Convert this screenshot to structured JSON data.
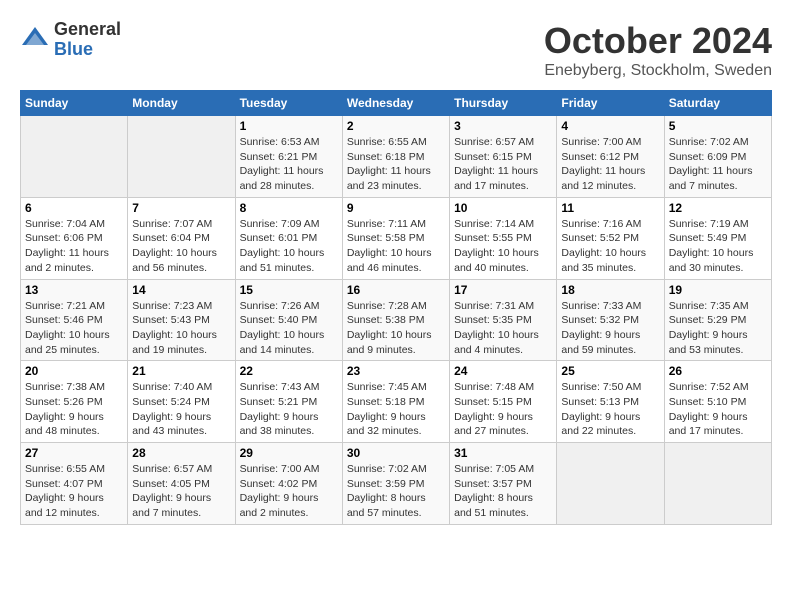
{
  "logo": {
    "general": "General",
    "blue": "Blue"
  },
  "header": {
    "month": "October 2024",
    "location": "Enebyberg, Stockholm, Sweden"
  },
  "weekdays": [
    "Sunday",
    "Monday",
    "Tuesday",
    "Wednesday",
    "Thursday",
    "Friday",
    "Saturday"
  ],
  "weeks": [
    [
      {
        "day": "",
        "info": ""
      },
      {
        "day": "",
        "info": ""
      },
      {
        "day": "1",
        "info": "Sunrise: 6:53 AM\nSunset: 6:21 PM\nDaylight: 11 hours and 28 minutes."
      },
      {
        "day": "2",
        "info": "Sunrise: 6:55 AM\nSunset: 6:18 PM\nDaylight: 11 hours and 23 minutes."
      },
      {
        "day": "3",
        "info": "Sunrise: 6:57 AM\nSunset: 6:15 PM\nDaylight: 11 hours and 17 minutes."
      },
      {
        "day": "4",
        "info": "Sunrise: 7:00 AM\nSunset: 6:12 PM\nDaylight: 11 hours and 12 minutes."
      },
      {
        "day": "5",
        "info": "Sunrise: 7:02 AM\nSunset: 6:09 PM\nDaylight: 11 hours and 7 minutes."
      }
    ],
    [
      {
        "day": "6",
        "info": "Sunrise: 7:04 AM\nSunset: 6:06 PM\nDaylight: 11 hours and 2 minutes."
      },
      {
        "day": "7",
        "info": "Sunrise: 7:07 AM\nSunset: 6:04 PM\nDaylight: 10 hours and 56 minutes."
      },
      {
        "day": "8",
        "info": "Sunrise: 7:09 AM\nSunset: 6:01 PM\nDaylight: 10 hours and 51 minutes."
      },
      {
        "day": "9",
        "info": "Sunrise: 7:11 AM\nSunset: 5:58 PM\nDaylight: 10 hours and 46 minutes."
      },
      {
        "day": "10",
        "info": "Sunrise: 7:14 AM\nSunset: 5:55 PM\nDaylight: 10 hours and 40 minutes."
      },
      {
        "day": "11",
        "info": "Sunrise: 7:16 AM\nSunset: 5:52 PM\nDaylight: 10 hours and 35 minutes."
      },
      {
        "day": "12",
        "info": "Sunrise: 7:19 AM\nSunset: 5:49 PM\nDaylight: 10 hours and 30 minutes."
      }
    ],
    [
      {
        "day": "13",
        "info": "Sunrise: 7:21 AM\nSunset: 5:46 PM\nDaylight: 10 hours and 25 minutes."
      },
      {
        "day": "14",
        "info": "Sunrise: 7:23 AM\nSunset: 5:43 PM\nDaylight: 10 hours and 19 minutes."
      },
      {
        "day": "15",
        "info": "Sunrise: 7:26 AM\nSunset: 5:40 PM\nDaylight: 10 hours and 14 minutes."
      },
      {
        "day": "16",
        "info": "Sunrise: 7:28 AM\nSunset: 5:38 PM\nDaylight: 10 hours and 9 minutes."
      },
      {
        "day": "17",
        "info": "Sunrise: 7:31 AM\nSunset: 5:35 PM\nDaylight: 10 hours and 4 minutes."
      },
      {
        "day": "18",
        "info": "Sunrise: 7:33 AM\nSunset: 5:32 PM\nDaylight: 9 hours and 59 minutes."
      },
      {
        "day": "19",
        "info": "Sunrise: 7:35 AM\nSunset: 5:29 PM\nDaylight: 9 hours and 53 minutes."
      }
    ],
    [
      {
        "day": "20",
        "info": "Sunrise: 7:38 AM\nSunset: 5:26 PM\nDaylight: 9 hours and 48 minutes."
      },
      {
        "day": "21",
        "info": "Sunrise: 7:40 AM\nSunset: 5:24 PM\nDaylight: 9 hours and 43 minutes."
      },
      {
        "day": "22",
        "info": "Sunrise: 7:43 AM\nSunset: 5:21 PM\nDaylight: 9 hours and 38 minutes."
      },
      {
        "day": "23",
        "info": "Sunrise: 7:45 AM\nSunset: 5:18 PM\nDaylight: 9 hours and 32 minutes."
      },
      {
        "day": "24",
        "info": "Sunrise: 7:48 AM\nSunset: 5:15 PM\nDaylight: 9 hours and 27 minutes."
      },
      {
        "day": "25",
        "info": "Sunrise: 7:50 AM\nSunset: 5:13 PM\nDaylight: 9 hours and 22 minutes."
      },
      {
        "day": "26",
        "info": "Sunrise: 7:52 AM\nSunset: 5:10 PM\nDaylight: 9 hours and 17 minutes."
      }
    ],
    [
      {
        "day": "27",
        "info": "Sunrise: 6:55 AM\nSunset: 4:07 PM\nDaylight: 9 hours and 12 minutes."
      },
      {
        "day": "28",
        "info": "Sunrise: 6:57 AM\nSunset: 4:05 PM\nDaylight: 9 hours and 7 minutes."
      },
      {
        "day": "29",
        "info": "Sunrise: 7:00 AM\nSunset: 4:02 PM\nDaylight: 9 hours and 2 minutes."
      },
      {
        "day": "30",
        "info": "Sunrise: 7:02 AM\nSunset: 3:59 PM\nDaylight: 8 hours and 57 minutes."
      },
      {
        "day": "31",
        "info": "Sunrise: 7:05 AM\nSunset: 3:57 PM\nDaylight: 8 hours and 51 minutes."
      },
      {
        "day": "",
        "info": ""
      },
      {
        "day": "",
        "info": ""
      }
    ]
  ]
}
